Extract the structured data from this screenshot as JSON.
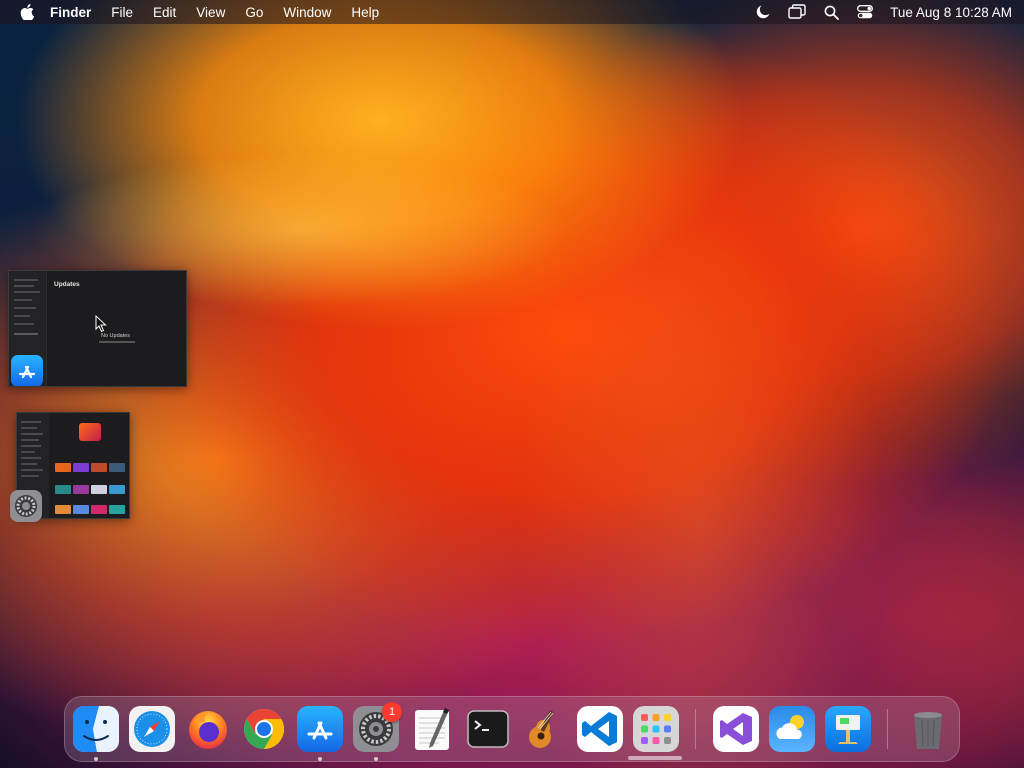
{
  "menubar": {
    "app_name": "Finder",
    "items": [
      "File",
      "Edit",
      "View",
      "Go",
      "Window",
      "Help"
    ],
    "clock": "Tue Aug 8  10:28 AM",
    "status_icons": [
      "moon-icon",
      "screen-mirroring-icon",
      "spotlight-search-icon",
      "control-center-icon"
    ]
  },
  "windows": {
    "app_store": {
      "title": "Updates",
      "message": "No Updates",
      "app_icon": "app-store-icon"
    },
    "system_settings": {
      "app_icon": "system-settings-icon"
    }
  },
  "dock": {
    "apps": [
      {
        "name": "Finder",
        "icon": "finder-icon",
        "running": true
      },
      {
        "name": "Safari",
        "icon": "safari-icon",
        "running": false
      },
      {
        "name": "Firefox",
        "icon": "firefox-icon",
        "running": false
      },
      {
        "name": "Google Chrome",
        "icon": "chrome-icon",
        "running": false
      },
      {
        "name": "App Store",
        "icon": "app-store-icon",
        "running": true
      },
      {
        "name": "System Settings",
        "icon": "system-settings-icon",
        "running": true,
        "badge": "1"
      },
      {
        "name": "TextEdit",
        "icon": "textedit-icon",
        "running": false
      },
      {
        "name": "Terminal",
        "icon": "terminal-icon",
        "running": false
      },
      {
        "name": "GarageBand",
        "icon": "garageband-icon",
        "running": false
      },
      {
        "name": "Visual Studio Code",
        "icon": "vscode-icon",
        "running": false
      },
      {
        "name": "Launchpad",
        "icon": "launchpad-icon",
        "running": false
      },
      {
        "name": "Visual Studio",
        "icon": "visual-studio-icon",
        "running": false
      },
      {
        "name": "Weather",
        "icon": "weather-icon",
        "running": false
      },
      {
        "name": "Keynote",
        "icon": "keynote-icon",
        "running": false
      },
      {
        "name": "Trash",
        "icon": "trash-icon",
        "running": false
      }
    ]
  },
  "colors": {
    "badge_red": "#ff3b30",
    "app_store_blue": "#1a8cff",
    "vscode_blue": "#0a7bd6"
  }
}
